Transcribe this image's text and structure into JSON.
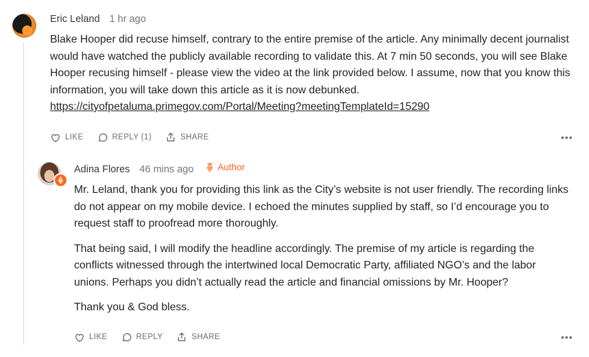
{
  "comments": [
    {
      "author": "Eric Leland",
      "time": "1 hr ago",
      "body": "Blake Hooper did recuse himself, contrary to the entire premise of the article. Any minimally decent journalist would have watched the publicly available recording to validate this. At 7 min 50 seconds, you will see Blake Hooper recusing himself - please view the video at the link provided below. I assume, now that you know this information, you will take down this article as it is now debunked.",
      "link": "https://cityofpetaluma.primegov.com/Portal/Meeting?meetingTemplateId=15290",
      "actions": {
        "like": "LIKE",
        "reply": "REPLY (1)",
        "share": "SHARE",
        "more": "•••"
      }
    },
    {
      "author": "Adina Flores",
      "time": "46 mins ago",
      "badge": "Author",
      "paragraphs": [
        "Mr. Leland, thank you for providing this link as the City’s website is not user friendly. The recording links do not appear on my mobile device. I echoed the minutes supplied by staff, so I’d encourage you to request staff to proofread more thoroughly.",
        "That being said, I will modify the headline accordingly. The premise of my article is regarding the conflicts witnessed through the intertwined local Democratic Party, affiliated NGO’s and the labor unions. Perhaps you didn’t actually read the article and financial omissions by Mr. Hooper?",
        "Thank you & God bless."
      ],
      "actions": {
        "like": "LIKE",
        "reply": "REPLY",
        "share": "SHARE",
        "more": "•••"
      }
    }
  ],
  "colors": {
    "accent": "#ff6719",
    "text": "#242424",
    "muted": "#757575"
  },
  "icons": [
    "heart-icon",
    "comment-bubble-icon",
    "share-icon",
    "pen-nib-icon",
    "more-icon"
  ]
}
